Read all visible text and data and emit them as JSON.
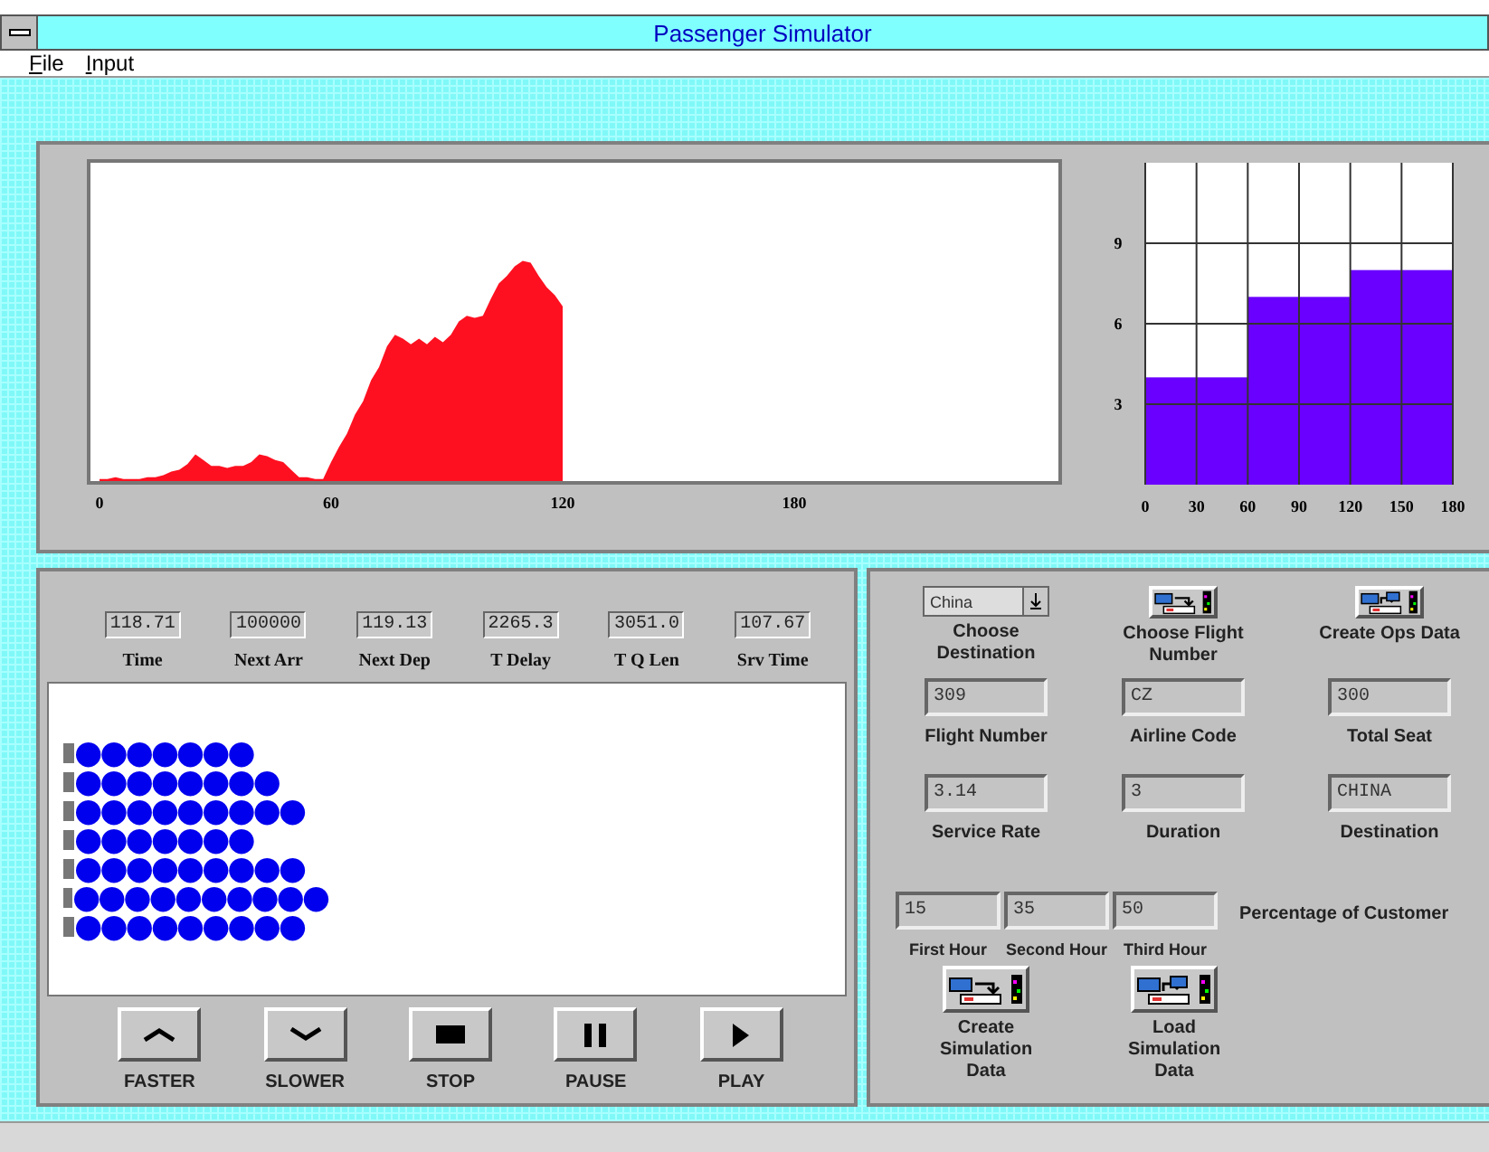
{
  "window": {
    "title": "Passenger Simulator"
  },
  "menu": [
    {
      "label": "File"
    },
    {
      "label": "Input"
    }
  ],
  "area_chart": {
    "x_tick_labels": [
      "0",
      "60",
      "120",
      "180"
    ]
  },
  "step_chart": {
    "chart_data": {
      "type": "bar",
      "x": [
        15,
        45,
        75,
        105,
        135,
        165
      ],
      "values": [
        4,
        4,
        7,
        7,
        8,
        8
      ],
      "xlim": [
        0,
        180
      ],
      "ylim": [
        0,
        12
      ],
      "xticks": [
        0,
        30,
        60,
        90,
        120,
        150,
        180
      ],
      "yticks": [
        3,
        6,
        9
      ],
      "grid": true
    }
  },
  "readouts": [
    {
      "label": "Time",
      "value": "118.71"
    },
    {
      "label": "Next Arr",
      "value": "100000"
    },
    {
      "label": "Next Dep",
      "value": "119.13"
    },
    {
      "label": "T Delay",
      "value": "2265.3"
    },
    {
      "label": "T Q Len",
      "value": "3051.0"
    },
    {
      "label": "Srv Time",
      "value": "107.67"
    }
  ],
  "queues": [
    {
      "passengers": "●●●●●●●"
    },
    {
      "passengers": "●●●●●●●●"
    },
    {
      "passengers": "●●●●●●●●●"
    },
    {
      "passengers": "●●●●●●●"
    },
    {
      "passengers": "●●●●●●●●●"
    },
    {
      "passengers": "●●●●●●●●●●"
    },
    {
      "passengers": "●●●●●●●●●"
    }
  ],
  "controls": [
    {
      "kind": "up",
      "label": "FASTER"
    },
    {
      "kind": "down",
      "label": "SLOWER"
    },
    {
      "kind": "stop",
      "label": "STOP"
    },
    {
      "kind": "pause",
      "label": "PAUSE"
    },
    {
      "kind": "play",
      "label": "PLAY"
    }
  ],
  "destination_select": {
    "value": "China",
    "label": "Choose Destination"
  },
  "action_buttons": [
    {
      "kind": "export",
      "label": "Choose Flight Number"
    },
    {
      "kind": "import",
      "label": "Create Ops Data"
    }
  ],
  "fields": [
    {
      "label": "Flight Number",
      "value": "309"
    },
    {
      "label": "Airline Code",
      "value": "CZ"
    },
    {
      "label": "Total Seat",
      "value": "300"
    },
    {
      "label": "Service Rate",
      "value": "3.14"
    },
    {
      "label": "Duration",
      "value": "3"
    },
    {
      "label": "Destination",
      "value": "CHINA"
    }
  ],
  "hours": [
    {
      "label": "First Hour",
      "value": "15"
    },
    {
      "label": "Second Hour",
      "value": "35"
    },
    {
      "label": "Third Hour",
      "value": "50"
    }
  ],
  "hours_caption": "Percentage of Customer",
  "sim_buttons": [
    {
      "kind": "export",
      "label": "Create Simulation Data"
    },
    {
      "kind": "import",
      "label": "Load Simulation Data"
    }
  ]
}
